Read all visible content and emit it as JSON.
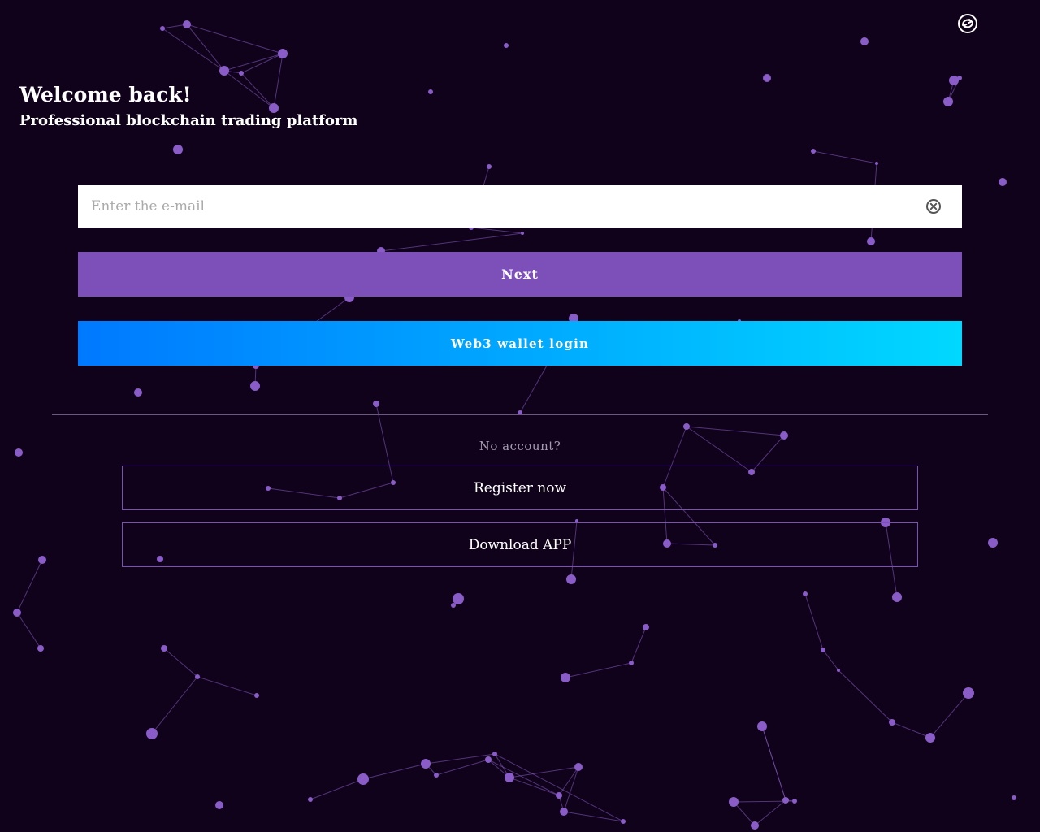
{
  "header": {
    "language_icon": "language-switch-icon"
  },
  "hero": {
    "title": "Welcome back!",
    "subtitle": "Professional blockchain trading platform"
  },
  "login_form": {
    "email_value": "",
    "email_placeholder": "Enter the e-mail",
    "clear_icon": "clear-circle-x-icon",
    "next_label": "Next",
    "web3_label": "Web3 wallet login"
  },
  "signup": {
    "prompt": "No account?",
    "register_label": "Register now",
    "download_label": "Download APP"
  },
  "colors": {
    "background": "#10021a",
    "accent_purple": "#7d4fb8",
    "node_purple": "#8a5cc8",
    "web3_gradient_start": "#0079ff",
    "web3_gradient_end": "#00d8ff",
    "muted_text": "#a39ab0"
  }
}
